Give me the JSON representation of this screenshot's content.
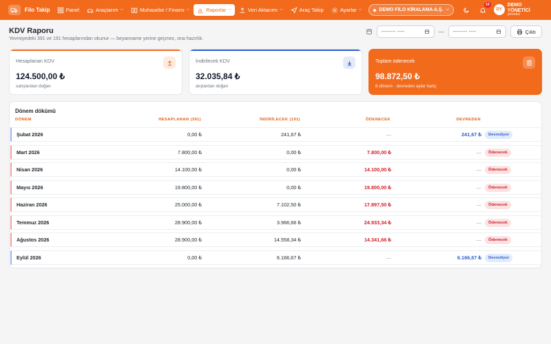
{
  "nav": {
    "brand": "Filo Takip",
    "items": [
      {
        "label": "Panel",
        "icon": "grid-icon",
        "chevron": false,
        "active": false
      },
      {
        "label": "Araçlarım",
        "icon": "car-icon",
        "chevron": true,
        "active": false
      },
      {
        "label": "Muhasebe / Finans",
        "icon": "book-icon",
        "chevron": true,
        "active": false
      },
      {
        "label": "Raporlar",
        "icon": "chart-icon",
        "chevron": true,
        "active": true
      },
      {
        "label": "Veri Aktarımı",
        "icon": "upload-icon",
        "chevron": true,
        "active": false
      },
      {
        "label": "Araç Takip",
        "icon": "gps-icon",
        "chevron": false,
        "active": false
      },
      {
        "label": "Ayarlar",
        "icon": "gear-icon",
        "chevron": true,
        "active": false
      }
    ],
    "company": "DEMO FİLO KİRALAMA A.Ş.",
    "notification_count": "16",
    "user_initials": "DY",
    "user_name": "DEMO YÖNETİCİ",
    "user_role": "yönetici"
  },
  "header": {
    "title": "KDV Raporu",
    "subtitle": "Yevmiyedeki 391 ve 191 hesaplarından okunur — beyanname yerine geçmez, ona hazırlık.",
    "date_from_placeholder": "-------- ----",
    "date_to_placeholder": "-------- ----",
    "print_label": "Çıktı"
  },
  "cards": [
    {
      "label": "Hesaplanan KDV",
      "value": "124.500,00 ₺",
      "note": "satışlardan doğan",
      "icon": "arrow-up-icon",
      "accent": "#f26b1d"
    },
    {
      "label": "İndirilecek KDV",
      "value": "32.035,84 ₺",
      "note": "alışlardan doğan",
      "icon": "arrow-down-icon",
      "accent": "#2f5fd0"
    },
    {
      "label": "Toplam ödenecek",
      "value": "98.872,50 ₺",
      "note": "8 dönem · devreden aylar hariç",
      "icon": "receipt-icon",
      "accent": "#f26b1d"
    }
  ],
  "table": {
    "title": "Dönem dökümü",
    "headers": {
      "period": "DÖNEM",
      "calculated": "HESAPLANAN (391)",
      "deductible": "İNDİRİLECEK (191)",
      "payable": "ÖDENECEK",
      "carried": "DEVREDEN"
    },
    "rows": [
      {
        "period": "Şubat 2026",
        "calculated": "0,00 ₺",
        "deductible": "241,67 ₺",
        "payable": "—",
        "carried": "241,67 ₺",
        "status": "Devrediyor",
        "kind": "carry"
      },
      {
        "period": "Mart 2026",
        "calculated": "7.800,00 ₺",
        "deductible": "0,00 ₺",
        "payable": "7.800,00 ₺",
        "carried": "—",
        "status": "Ödenecek",
        "kind": "pay"
      },
      {
        "period": "Nisan 2026",
        "calculated": "14.100,00 ₺",
        "deductible": "0,00 ₺",
        "payable": "14.100,00 ₺",
        "carried": "—",
        "status": "Ödenecek",
        "kind": "pay"
      },
      {
        "period": "Mayıs 2026",
        "calculated": "19.800,00 ₺",
        "deductible": "0,00 ₺",
        "payable": "19.800,00 ₺",
        "carried": "—",
        "status": "Ödenecek",
        "kind": "pay"
      },
      {
        "period": "Haziran 2026",
        "calculated": "25.000,00 ₺",
        "deductible": "7.102,50 ₺",
        "payable": "17.897,50 ₺",
        "carried": "—",
        "status": "Ödenecek",
        "kind": "pay"
      },
      {
        "period": "Temmuz 2026",
        "calculated": "28.900,00 ₺",
        "deductible": "3.966,66 ₺",
        "payable": "24.933,34 ₺",
        "carried": "—",
        "status": "Ödenecek",
        "kind": "pay"
      },
      {
        "period": "Ağustos 2026",
        "calculated": "28.900,00 ₺",
        "deductible": "14.558,34 ₺",
        "payable": "14.341,66 ₺",
        "carried": "—",
        "status": "Ödenecek",
        "kind": "pay"
      },
      {
        "period": "Eylül 2026",
        "calculated": "0,00 ₺",
        "deductible": "6.166,67 ₺",
        "payable": "—",
        "carried": "6.166,67 ₺",
        "status": "Devrediyor",
        "kind": "carry"
      }
    ]
  },
  "colors": {
    "brand": "#f26b1d",
    "payable": "#d4202c",
    "carry": "#2f5fd0"
  }
}
